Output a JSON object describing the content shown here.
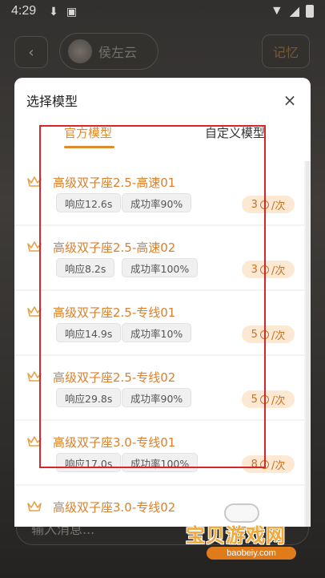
{
  "status_bar": {
    "time": "4:29"
  },
  "background": {
    "character_name": "侯左云",
    "memory_label": "记忆",
    "input_placeholder": "输入消息..."
  },
  "modal": {
    "title": "选择模型",
    "tabs": [
      {
        "label": "官方模型",
        "active": true
      },
      {
        "label": "自定义模型",
        "active": false
      }
    ],
    "items": [
      {
        "name": "高级双子座2.5-高速01",
        "response": "响应12.6s",
        "success": "成功率90%",
        "cost": "3",
        "unit": "/次"
      },
      {
        "name": "高级双子座2.5-高速02",
        "response": "响应8.2s",
        "success": "成功率100%",
        "cost": "3",
        "unit": "/次"
      },
      {
        "name": "高级双子座2.5-专线01",
        "response": "响应14.9s",
        "success": "成功率10%",
        "cost": "5",
        "unit": "/次"
      },
      {
        "name": "高级双子座2.5-专线02",
        "response": "响应29.8s",
        "success": "成功率90%",
        "cost": "5",
        "unit": "/次"
      },
      {
        "name": "高级双子座3.0-专线01",
        "response": "响应17.0s",
        "success": "成功率100%",
        "cost": "8",
        "unit": "/次"
      },
      {
        "name": "高级双子座3.0-专线02",
        "response": "",
        "success": "",
        "cost": "",
        "unit": ""
      }
    ]
  },
  "watermark": {
    "text": "宝贝游戏网",
    "url": "baobeiy.com"
  },
  "colors": {
    "accent": "#e08a2e",
    "annotation": "#d6262b"
  }
}
